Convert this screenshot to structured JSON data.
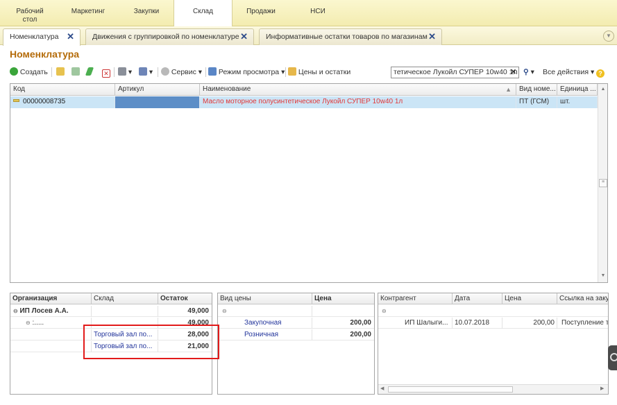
{
  "sections": [
    {
      "label": "Рабочий\nстол",
      "active": false
    },
    {
      "label": "Маркетинг",
      "active": false
    },
    {
      "label": "Закупки",
      "active": false
    },
    {
      "label": "Склад",
      "active": true
    },
    {
      "label": "Продажи",
      "active": false
    },
    {
      "label": "НСИ",
      "active": false
    }
  ],
  "tabs": [
    {
      "label": "Номенклатура",
      "active": true
    },
    {
      "label": "Движения с группировкой по номенклатуре",
      "active": false
    },
    {
      "label": "Информативные остатки товаров по магазинам",
      "active": false
    }
  ],
  "page_title": "Номенклатура",
  "toolbar": {
    "create": "Создать",
    "service": "Сервис",
    "view_mode": "Режим просмотра",
    "prices": "Цены и остатки",
    "all_actions": "Все действия",
    "search_value": "тетическое Лукойл СУПЕР 10w40 1л"
  },
  "main_table": {
    "headers": [
      "Код",
      "Артикул",
      "Наименование",
      "Вид номе...",
      "Единица ..."
    ],
    "rows": [
      {
        "code": "00000008735",
        "article": "",
        "name": "Масло моторное полусинтетическое Лукойл СУПЕР 10w40 1л",
        "kind": "ПТ (ГСМ)",
        "unit": "шт."
      }
    ]
  },
  "stock_table": {
    "headers": [
      "Организация",
      "Склад",
      "Остаток"
    ],
    "rows": [
      {
        "org": "ИП Лосев А.А.",
        "warehouse": "",
        "qty": "49,000"
      },
      {
        "org": ":.....",
        "warehouse": "",
        "qty": "49,000"
      },
      {
        "org": "",
        "warehouse": "Торговый зал по...",
        "qty": "28,000"
      },
      {
        "org": "",
        "warehouse": "Торговый зал по...",
        "qty": "21,000"
      }
    ]
  },
  "price_table": {
    "headers": [
      "Вид цены",
      "Цена"
    ],
    "rows": [
      {
        "kind": "Закупочная",
        "price": "200,00"
      },
      {
        "kind": "Розничная",
        "price": "200,00"
      }
    ]
  },
  "supply_table": {
    "headers": [
      "Контрагент",
      "Дата",
      "Цена",
      "Ссылка на заку"
    ],
    "rows": [
      {
        "partner": "ИП Шалыги...",
        "date": "10.07.2018",
        "price": "200,00",
        "link": "Поступление то"
      }
    ]
  },
  "colors": {
    "accent": "#b46b09",
    "selected_row": "#cbe5f6",
    "highlight_box": "#e21a1a",
    "link_text": "#22349b"
  }
}
